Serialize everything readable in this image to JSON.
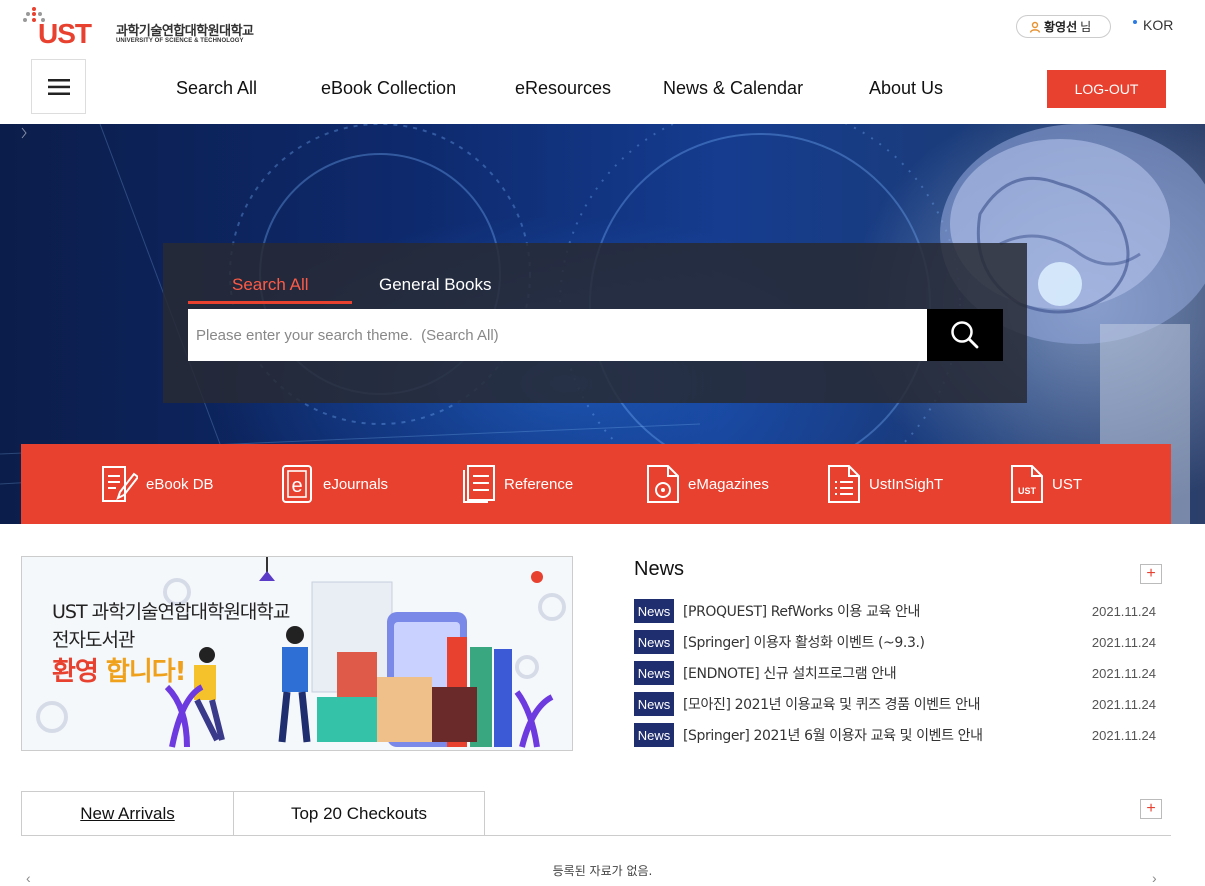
{
  "brand": {
    "logo_text": "UST",
    "logo_korean": "과학기술연합대학원대학교",
    "logo_english": "UNIVERSITY OF SCIENCE & TECHNOLOGY",
    "accent": "#e8412f",
    "navy": "#1f2e6e"
  },
  "utility": {
    "user_name": "황영선",
    "user_suffix": "님",
    "language": "KOR"
  },
  "nav": {
    "menu_icon": "hamburger-icon",
    "items": [
      "Search All",
      "eBook Collection",
      "eResources",
      "News & Calendar",
      "About Us"
    ],
    "logout_label": "LOG-OUT"
  },
  "search": {
    "tabs": [
      "Search All",
      "General Books"
    ],
    "active_tab": "Search All",
    "placeholder": "Please enter your search theme.  (Search All)",
    "button_icon": "search-icon"
  },
  "quick_links": [
    {
      "label": "eBook DB",
      "icon": "ebook-db-icon"
    },
    {
      "label": "eJournals",
      "icon": "ejournals-icon"
    },
    {
      "label": "Reference",
      "icon": "reference-icon"
    },
    {
      "label": "eMagazines",
      "icon": "emagazines-icon"
    },
    {
      "label": "UstInSighT",
      "icon": "ustinsight-icon"
    },
    {
      "label": "UST",
      "icon": "ust-doc-icon"
    }
  ],
  "banner": {
    "line1": "UST 과학기술연합대학원대학교",
    "line2": "전자도서관",
    "line3a": "환영",
    "line3b": "합니다!"
  },
  "news": {
    "title": "News",
    "more_label": "+",
    "items": [
      {
        "badge": "News",
        "title": "[PROQUEST] RefWorks 이용 교육 안내",
        "date": "2021.11.24"
      },
      {
        "badge": "News",
        "title": "[Springer] 이용자 활성화 이벤트 (~9.3.)",
        "date": "2021.11.24"
      },
      {
        "badge": "News",
        "title": "[ENDNOTE] 신규 설치프로그램 안내",
        "date": "2021.11.24"
      },
      {
        "badge": "News",
        "title": "[모아진] 2021년 이용교육 및 퀴즈 경품 이벤트 안내",
        "date": "2021.11.24"
      },
      {
        "badge": "News",
        "title": "[Springer] 2021년 6월 이용자 교육 및 이벤트 안내",
        "date": "2021.11.24"
      }
    ]
  },
  "books": {
    "tabs": [
      "New Arrivals",
      "Top 20 Checkouts"
    ],
    "active_tab": "New Arrivals",
    "more_label": "+",
    "empty_message": "등록된 자료가 없음.",
    "prev_arrow": "‹",
    "next_arrow": "›"
  }
}
